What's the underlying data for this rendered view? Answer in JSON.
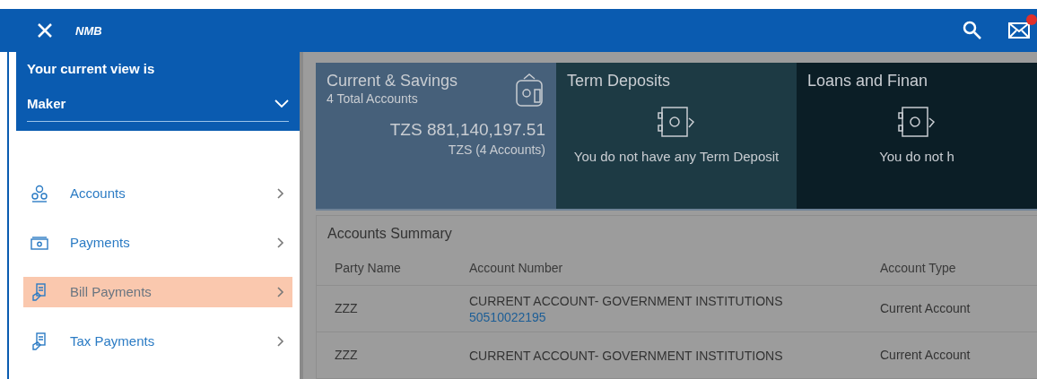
{
  "header": {
    "logo": "NMB"
  },
  "sidebar": {
    "view_label": "Your current view is",
    "view_value": "Maker",
    "items": [
      {
        "label": "Accounts",
        "kind": "users",
        "selected": false
      },
      {
        "label": "Payments",
        "kind": "cash",
        "selected": false
      },
      {
        "label": "Bill Payments",
        "kind": "bill",
        "selected": true
      },
      {
        "label": "Tax Payments",
        "kind": "bill",
        "selected": false
      }
    ]
  },
  "cards": [
    {
      "kind": "summary",
      "title": "Current & Savings",
      "subtitle": "4 Total Accounts",
      "amount": "TZS 881,140,197.51",
      "note": "TZS (4 Accounts)"
    },
    {
      "kind": "empty",
      "title": "Term Deposits",
      "message": "You do not have any Term Deposit"
    },
    {
      "kind": "empty",
      "title": "Loans and Finan",
      "message": "You do not h"
    }
  ],
  "summary": {
    "title": "Accounts Summary",
    "columns": [
      "Party Name",
      "Account Number",
      "Account Type"
    ],
    "rows": [
      {
        "party": "ZZZ",
        "account_name": "CURRENT ACCOUNT- GOVERNMENT INSTITUTIONS",
        "account_number": "50510022195",
        "type": "Current Account"
      },
      {
        "party": "ZZZ",
        "account_name": "CURRENT ACCOUNT- GOVERNMENT INSTITUTIONS",
        "type": "Current Account"
      }
    ]
  }
}
